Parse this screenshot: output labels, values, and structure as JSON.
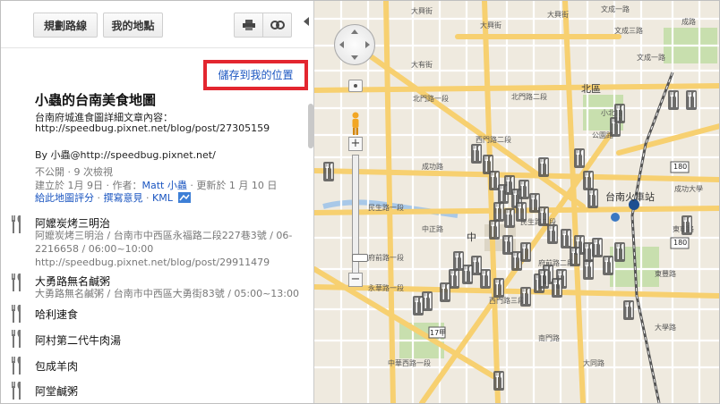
{
  "toolbar": {
    "directions_label": "規劃路線",
    "my_places_label": "我的地點",
    "print_icon": "print-icon",
    "link_icon": "link-icon"
  },
  "save": {
    "label": "儲存到我的位置",
    "highlight_color": "#e3262f"
  },
  "mapinfo": {
    "title": "小蟲的台南美食地圖",
    "desc_line1": "台南府城進食圖詳細文章內容：",
    "desc_line2": "http://speedbug.pixnet.net/blog/post/27305159",
    "by_line": "By 小蟲@http://speedbug.pixnet.net/",
    "stats_prefix": "不公開 · 9 次檢視",
    "created_text": "建立於 1月 9日 · 作者：",
    "author": "Matt 小蟲",
    "updated_text": " · 更新於 1 月 10 日",
    "rate_link": "給此地圖評分",
    "review_link": "撰寫意見",
    "kml_link": "KML"
  },
  "places": [
    {
      "name": "阿嬤炭烤三明治",
      "desc1": "阿嬤炭烤三明治 / 台南市中西區永福路二段227巷3號 / 06-",
      "desc2": "2216658 / 06:00~10:00",
      "desc3": "http://speedbug.pixnet.net/blog/post/29911479"
    },
    {
      "name": "大勇路無名鹹粥",
      "desc1": "大勇路無名鹹粥 / 台南市中西區大勇街83號 / 05:00~13:00"
    },
    {
      "name": "哈利速食"
    },
    {
      "name": "阿村第二代牛肉湯"
    },
    {
      "name": "包成羊肉"
    },
    {
      "name": "阿堂鹹粥"
    }
  ],
  "map": {
    "labels_big": [
      "北區",
      "台南火車站",
      "中"
    ],
    "labels": [
      "大興街",
      "大興街",
      "大興街",
      "文成三路",
      "成路",
      "大有街",
      "文成一路",
      "文成一路",
      "北門路一段",
      "北門路二段",
      "成功路",
      "西門路二段",
      "西門路三段",
      "公園路",
      "東豐路",
      "民生路一段",
      "民生路二段",
      "府前路一段",
      "府前路二段",
      "永華路一段",
      "南門路",
      "大同路",
      "中華西路一段",
      "成功大學",
      "東寧路",
      "小北路",
      "大學路",
      "中正路"
    ],
    "route_shields": [
      "180",
      "180",
      "17甲"
    ],
    "colors": {
      "major_road": "#f7d070",
      "park": "#c8dfae",
      "water": "#a8c8e8",
      "rail": "#555555"
    }
  }
}
